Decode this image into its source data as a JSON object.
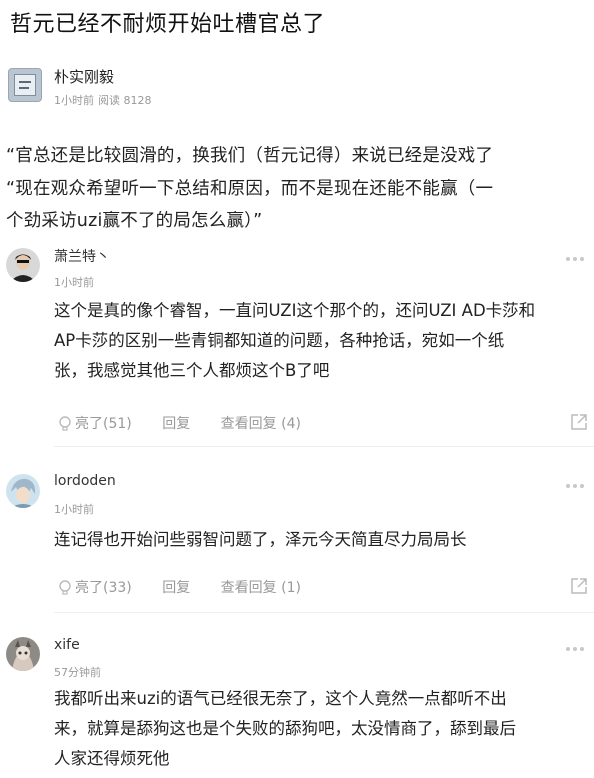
{
  "title": "哲元已经不耐烦开始吐槽官总了",
  "post": {
    "author": "朴实刚毅",
    "time": "1小时前",
    "reads": "阅读 8128",
    "avatar_text": ""
  },
  "quote": {
    "line1": "“官总还是比较圆滑的，换我们（哲元记得）来说已经是没戏了",
    "line2": "“现在观众希望听一下总结和原因，而不是现在还能不能赢（一",
    "line3": "个劲采访uzi赢不了的局怎么赢）”"
  },
  "comments": [
    {
      "name": "萧兰特丶",
      "time": "1小时前",
      "lines": [
        "这个是真的像个睿智，一直问UZI这个那个的，还问UZI AD卡莎和",
        "AP卡莎的区别一些青铜都知道的问题，各种抢话，宛如一个纸",
        "张，我感觉其他三个人都烦这个B了吧"
      ],
      "likes": "亮了(51)",
      "reply": "回复",
      "view_replies": "查看回复 (4)"
    },
    {
      "name": "lordoden",
      "time": "1小时前",
      "lines": [
        "连记得也开始问些弱智问题了，泽元今天简直尽力局局长"
      ],
      "likes": "亮了(33)",
      "reply": "回复",
      "view_replies": "查看回复 (1)"
    },
    {
      "name": "xife",
      "time": "57分钟前",
      "lines": [
        "我都听出来uzi的语气已经很无奈了，这个人竟然一点都听不出",
        "来，就算是舔狗这也是个失败的舔狗吧，太没情商了，舔到最后",
        "人家还得烦死他"
      ]
    }
  ],
  "icons": {
    "like": "lightbulb-icon",
    "share": "share-icon",
    "more": "more-dots-icon"
  },
  "colors": {
    "muted": "#999999",
    "text": "#222222",
    "divider": "#eeeeee"
  }
}
